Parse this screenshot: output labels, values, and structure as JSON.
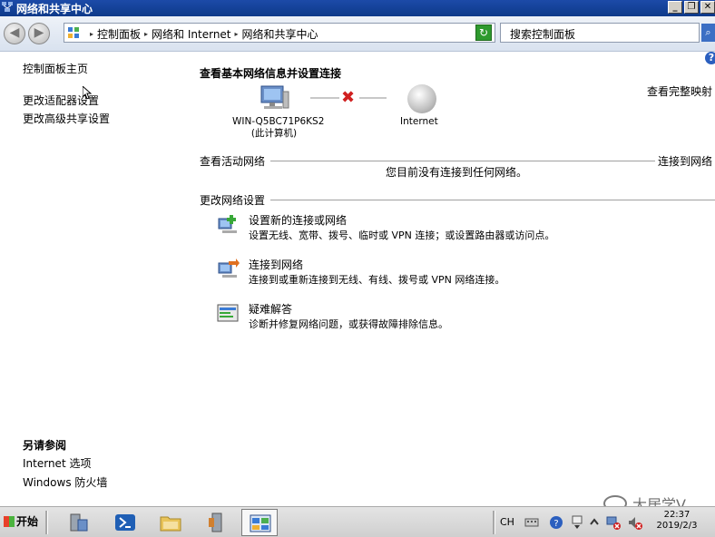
{
  "window": {
    "title": "网络和共享中心"
  },
  "address_bar": {
    "crumbs": [
      "控制面板",
      "网络和 Internet",
      "网络和共享中心"
    ],
    "search_placeholder": "搜索控制面板"
  },
  "left_panel": {
    "links": [
      "控制面板主页",
      "更改适配器设置",
      "更改高级共享设置"
    ],
    "see_also_title": "另请参阅",
    "see_also_links": [
      "Internet 选项",
      "Windows 防火墙"
    ]
  },
  "main": {
    "heading": "查看基本网络信息并设置连接",
    "full_map_link": "查看完整映射",
    "computer_name": "WIN-Q5BC71P6KS2",
    "computer_sub": "(此计算机)",
    "internet_label": "Internet",
    "active_networks": {
      "label": "查看活动网络",
      "link": "连接到网络",
      "status": "您目前没有连接到任何网络。"
    },
    "change_settings_label": "更改网络设置",
    "tasks": [
      {
        "title": "设置新的连接或网络",
        "desc": "设置无线、宽带、拨号、临时或 VPN 连接；或设置路由器或访问点。",
        "icon": "new-connection-icon"
      },
      {
        "title": "连接到网络",
        "desc": "连接到或重新连接到无线、有线、拨号或 VPN 网络连接。",
        "icon": "connect-network-icon"
      },
      {
        "title": "疑难解答",
        "desc": "诊断并修复网络问题，或获得故障排除信息。",
        "icon": "troubleshoot-icon"
      }
    ]
  },
  "taskbar": {
    "start_label": "开始",
    "language": "CH",
    "time": "22:37",
    "date": "2019/2/3"
  },
  "watermark": "大居学V",
  "colors": {
    "titlebar": "#1c4aa8",
    "link": "#000000",
    "error_x": "#d02020"
  }
}
